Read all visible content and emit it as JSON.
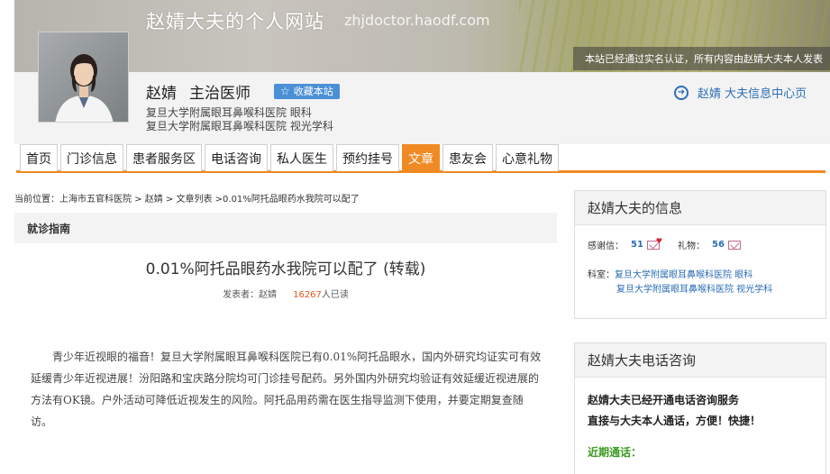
{
  "header": {
    "site_title": "赵婧大夫的个人网站",
    "site_domain": "zhjdoctor.haodf.com",
    "notice": "本站已经通过实名认证，所有内容由赵婧大夫本人发表"
  },
  "doctor": {
    "name": "赵婧",
    "title": "主治医师",
    "favorite_label": "收藏本站",
    "dept_lines": [
      "复旦大学附属眼耳鼻喉科医院  眼科",
      "复旦大学附属眼耳鼻喉科医院  视光学科"
    ],
    "info_center_label": "赵婧  大夫信息中心页"
  },
  "nav": {
    "items": [
      {
        "label": "首页"
      },
      {
        "label": "门诊信息"
      },
      {
        "label": "患者服务区"
      },
      {
        "label": "电话咨询"
      },
      {
        "label": "私人医生"
      },
      {
        "label": "预约挂号"
      },
      {
        "label": "文章"
      },
      {
        "label": "患友会"
      },
      {
        "label": "心意礼物"
      }
    ],
    "active_index": 6,
    "accent_color": "#f08a24"
  },
  "breadcrumb": "当前位置：上海市五官科医院 > 赵婧 > 文章列表 >0.01%阿托品眼药水我院可以配了",
  "guide_label": "就诊指南",
  "article": {
    "title": "0.01%阿托品眼药水我院可以配了 (转载)",
    "author_label": "发表者：赵婧",
    "read_count": "16267",
    "read_suffix": "人已读",
    "body": "青少年近视眼的福音！复旦大学附属眼耳鼻喉科医院已有0.01%阿托品眼水，国内外研究均证实可有效延缓青少年近视进展！汾阳路和宝庆路分院均可门诊挂号配药。另外国内外研究均验证有效延缓近视进展的方法有OK镜。户外活动可降低近视发生的风险。阿托品用药需在医生指导监测下使用，并要定期复查随访。"
  },
  "sidebar": {
    "info_box": {
      "title": "赵婧大夫的信息",
      "thanks_label": "感谢信：",
      "thanks_value": "51",
      "gift_label": "礼物：",
      "gift_value": "56",
      "dept_label": "科室：",
      "dept1": "复旦大学附属眼耳鼻喉科医院 眼科",
      "dept2": "复旦大学附属眼耳鼻喉科医院 视光学科"
    },
    "phone_box": {
      "title": "赵婧大夫电话咨询",
      "line1": "赵婧大夫已经开通电话咨询服务",
      "line2": "直接与大夫本人通话，方便！快捷！",
      "recent_label": "近期通话："
    }
  },
  "icons": [
    "star-icon",
    "arrow-right-circle-icon",
    "heart-letter-icon",
    "gift-letter-icon"
  ]
}
